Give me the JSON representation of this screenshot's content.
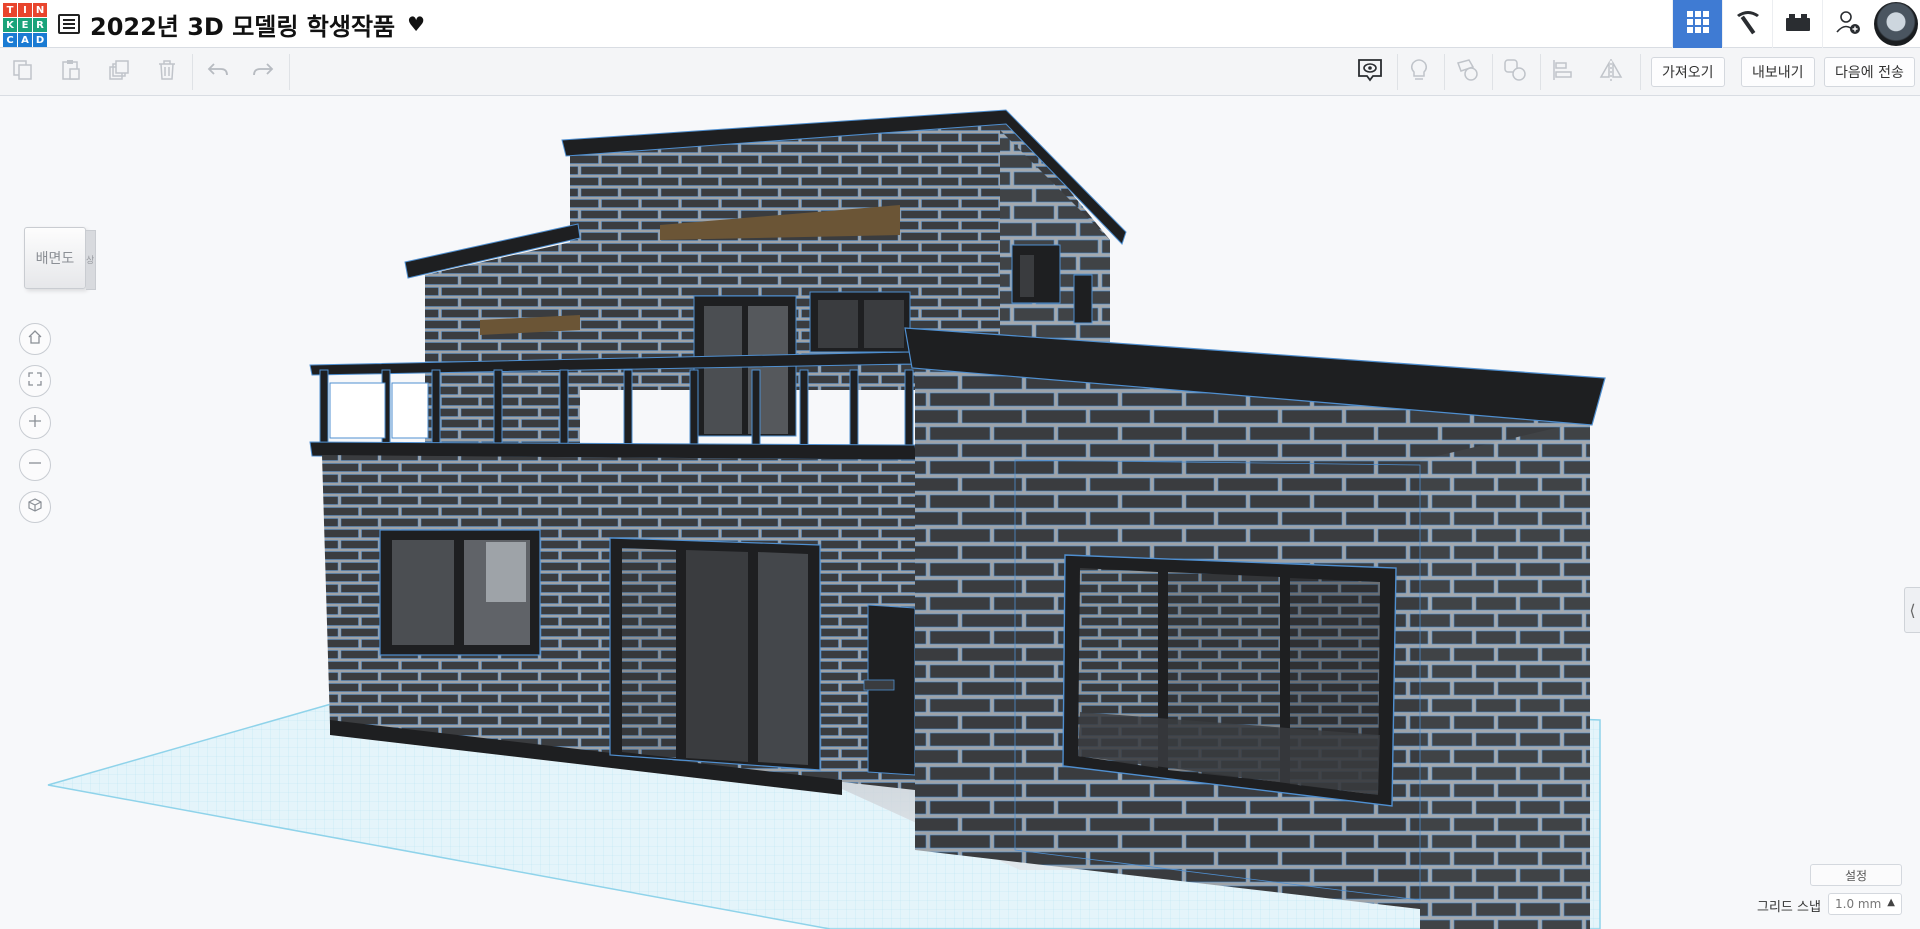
{
  "app": {
    "logo_letters": [
      "T",
      "I",
      "N",
      "K",
      "E",
      "R",
      "C",
      "A",
      "D"
    ],
    "logo_colors": [
      "#e8452d",
      "#e8452d",
      "#e8452d",
      "#1aa37a",
      "#1aa37a",
      "#1aa37a",
      "#1a7bd3",
      "#1a7bd3",
      "#1a7bd3"
    ],
    "project_title": "2022년 3D 모델링 학생작품",
    "title_suffix": "♥",
    "accent_color": "#3f7bd3"
  },
  "header_right": {
    "buttons": [
      {
        "icon": "grid-view-icon",
        "active": true
      },
      {
        "icon": "pickaxe-icon",
        "active": false
      },
      {
        "icon": "bricks-icon",
        "active": false
      },
      {
        "icon": "add-user-icon",
        "active": false
      }
    ]
  },
  "toolbar": {
    "left_tools": [
      "copy-icon",
      "paste-icon",
      "duplicate-icon",
      "delete-icon",
      "undo-icon",
      "redo-icon"
    ],
    "right_tools": [
      "notes-icon",
      "lightbulb-icon",
      "workplane-icon",
      "ruler-icon",
      "align-icon",
      "mirror-icon"
    ],
    "import_label": "가져오기",
    "export_label": "내보내기",
    "send_to_label": "다음에 전송"
  },
  "viewport": {
    "viewcube_front": "배면도",
    "viewcube_side": "상면도",
    "nav_buttons": [
      "home-view-icon",
      "fit-all-icon",
      "zoom-in-icon",
      "zoom-out-icon",
      "perspective-icon"
    ],
    "settings_label": "설정",
    "grid_snap_label": "그리드 스냅",
    "grid_snap_value": "1.0 mm",
    "colors": {
      "wall": "#3a3c3f",
      "mortar": "#9ea3a8",
      "edge": "#4f8fd0",
      "roof": "#1e1f21",
      "wood": "#6b5536",
      "grid": "#8fd3ea"
    }
  }
}
